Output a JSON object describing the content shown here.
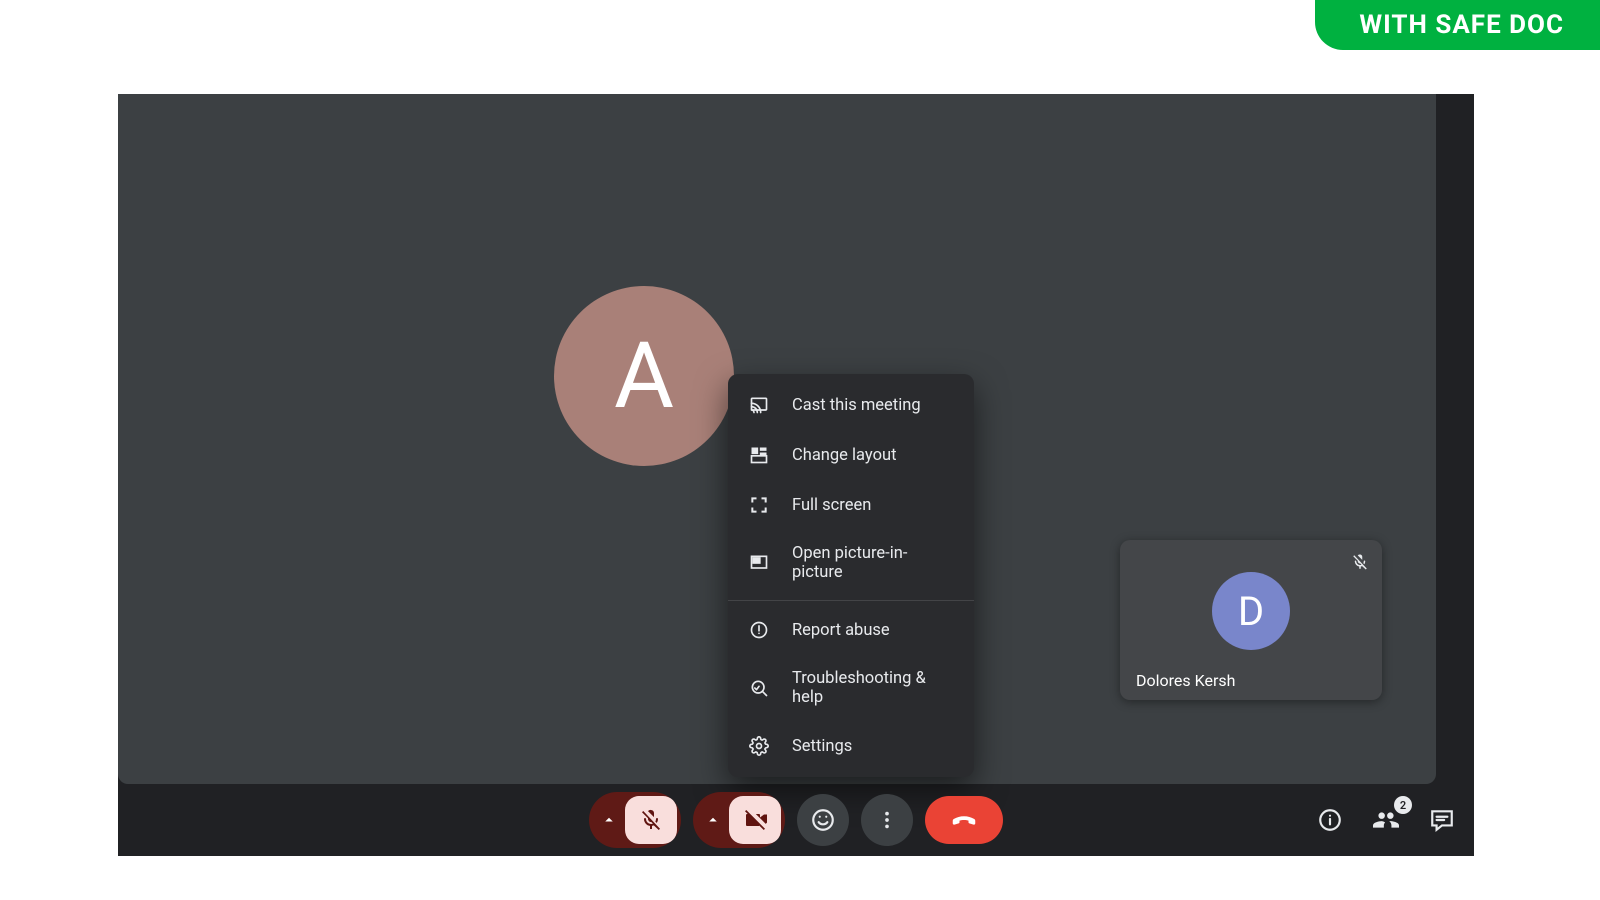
{
  "badge": {
    "label": "WITH SAFE DOC"
  },
  "main_participant": {
    "initial": "A"
  },
  "self_view": {
    "initial": "D",
    "name": "Dolores Kersh"
  },
  "menu": {
    "items": [
      {
        "label": "Cast this meeting"
      },
      {
        "label": "Change layout"
      },
      {
        "label": "Full screen"
      },
      {
        "label": "Open picture-in-picture"
      }
    ],
    "items2": [
      {
        "label": "Report abuse"
      },
      {
        "label": "Troubleshooting & help"
      },
      {
        "label": "Settings"
      }
    ]
  },
  "participants_count": "2"
}
